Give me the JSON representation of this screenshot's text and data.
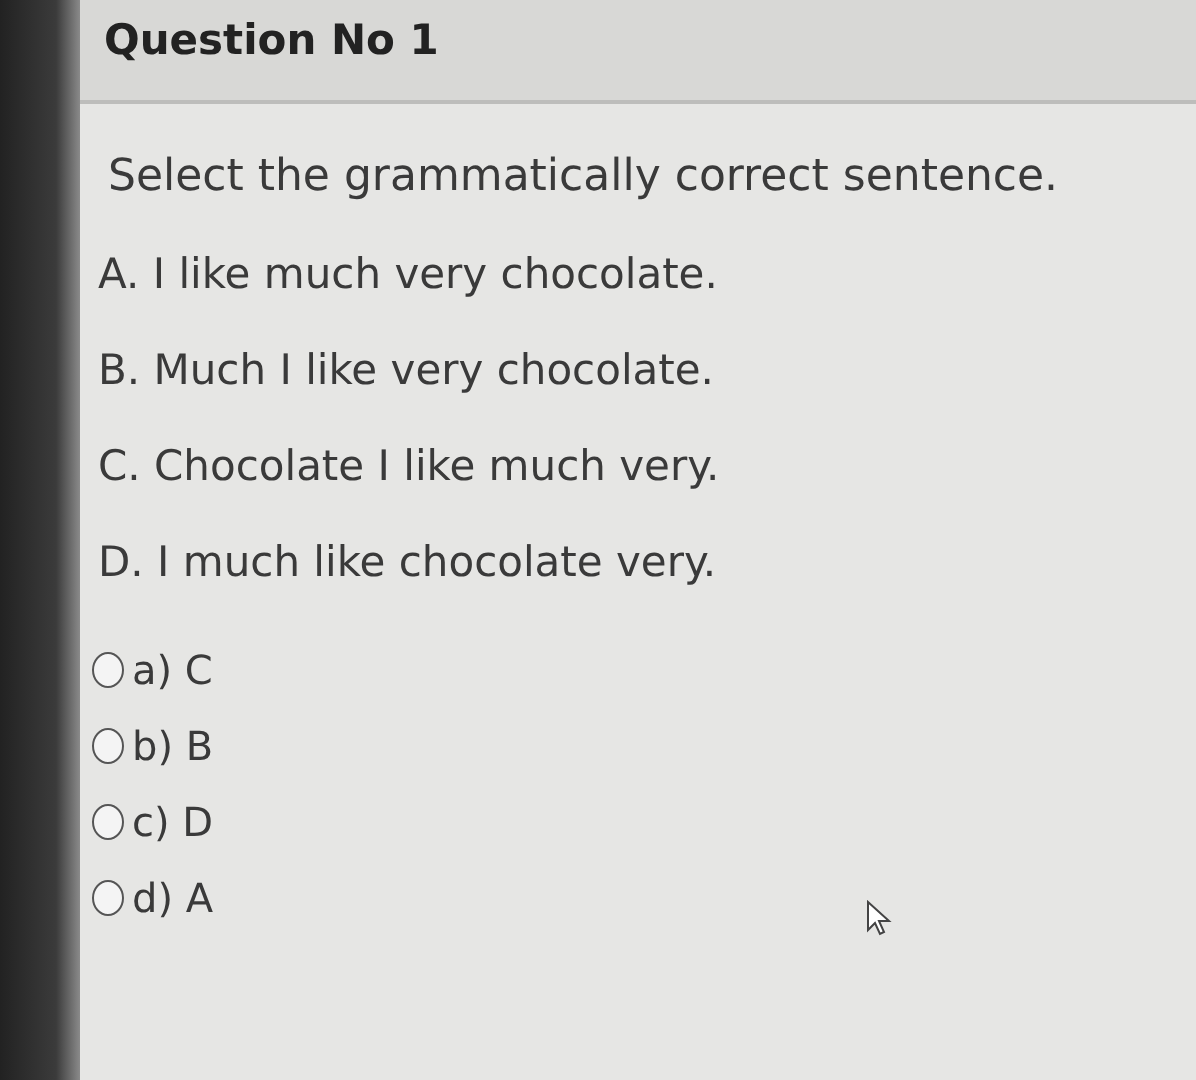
{
  "question": {
    "title": "Question No 1",
    "prompt": "Select the grammatically correct sentence.",
    "statements": [
      "A. I like much very chocolate.",
      "B. Much I like very chocolate.",
      "C. Chocolate I like much very.",
      "D. I much like chocolate very."
    ],
    "choices": [
      {
        "label": "a) C",
        "selected": false
      },
      {
        "label": "b) B",
        "selected": false
      },
      {
        "label": "c) D",
        "selected": false
      },
      {
        "label": "d) A",
        "selected": false
      }
    ]
  }
}
